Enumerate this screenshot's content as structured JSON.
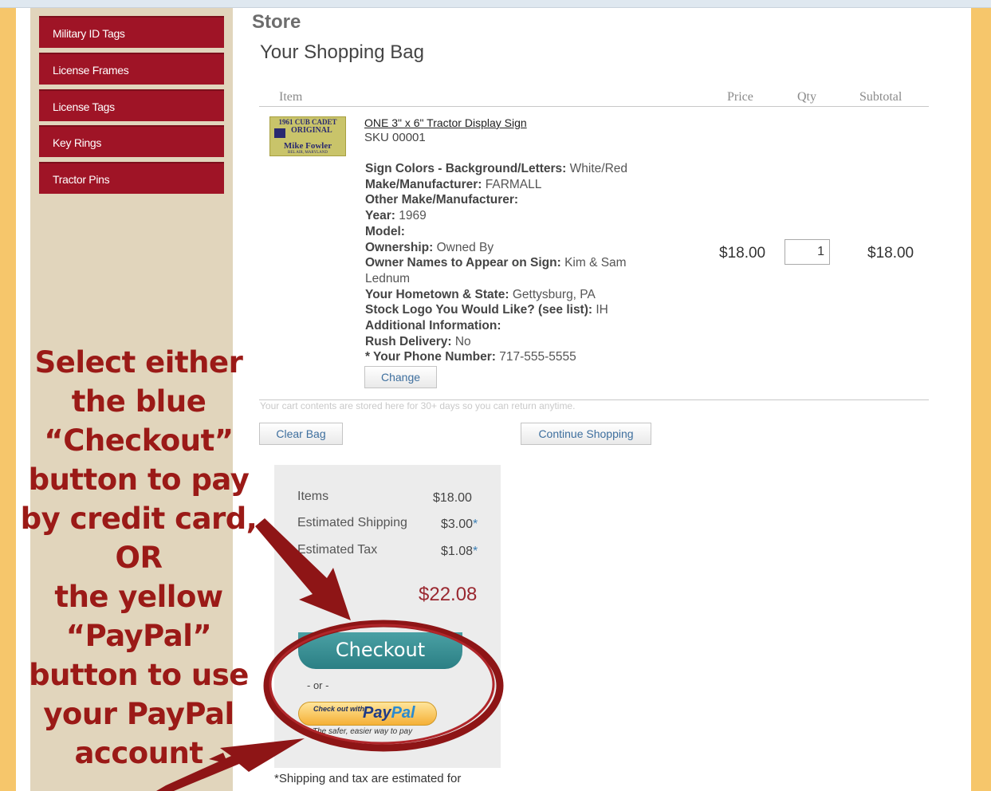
{
  "sidebar": {
    "categories": [
      "Military ID Tags",
      "License Frames",
      "License Tags",
      "Key Rings",
      "Tractor Pins"
    ]
  },
  "store": {
    "title": "Store",
    "bag_title": "Your Shopping Bag"
  },
  "cart_table": {
    "headers": {
      "item": "Item",
      "price": "Price",
      "qty": "Qty",
      "subtotal": "Subtotal"
    }
  },
  "product": {
    "thumbnail_text": [
      "1961 CUB CADET",
      "ORIGINAL",
      "Mike Fowler",
      "BEL AIR, MARYLAND"
    ],
    "name": "ONE 3\" x 6\" Tractor Display Sign",
    "sku": "SKU 00001",
    "options": [
      {
        "label": "Sign Colors - Background/Letters:",
        "value": "White/Red"
      },
      {
        "label": "Make/Manufacturer:",
        "value": "FARMALL"
      },
      {
        "label": "Other Make/Manufacturer:",
        "value": ""
      },
      {
        "label": "Year:",
        "value": "1969"
      },
      {
        "label": "Model:",
        "value": ""
      },
      {
        "label": "Ownership:",
        "value": "Owned By"
      },
      {
        "label": "Owner Names to Appear on Sign:",
        "value": "Kim & Sam Lednum"
      },
      {
        "label": "Your Hometown & State:",
        "value": "Gettysburg, PA"
      },
      {
        "label": "Stock Logo You Would Like? (see list):",
        "value": "IH"
      },
      {
        "label": "Additional Information:",
        "value": ""
      },
      {
        "label": "Rush Delivery:",
        "value": "No"
      },
      {
        "label": "* Your Phone Number:",
        "value": "717-555-5555"
      }
    ],
    "change_label": "Change",
    "price": "$18.00",
    "qty": "1",
    "subtotal": "$18.00"
  },
  "cart_note": "Your cart contents are stored here for 30+ days so you can return anytime.",
  "actions": {
    "clear_bag": "Clear Bag",
    "continue_shopping": "Continue Shopping"
  },
  "summary": {
    "items_label": "Items",
    "items_value": "$18.00",
    "shipping_label": "Estimated Shipping",
    "shipping_value": "$3.00",
    "tax_label": "Estimated Tax",
    "tax_value": "$1.08",
    "asterisk": "*",
    "total_value": "$22.08",
    "checkout_label": "Checkout",
    "or_label": "- or -",
    "paypal_small": "Check out with",
    "paypal_logo_a": "Pay",
    "paypal_logo_b": "Pal",
    "paypal_tagline": "The safer, easier way to pay",
    "footnote": "*Shipping and tax are estimated for"
  },
  "callout": {
    "lines": [
      "Select either",
      "the blue",
      "“Checkout”",
      "button to pay",
      "by credit card,",
      "OR",
      "the yellow",
      "“PayPal”",
      "button to use",
      "your PayPal",
      "account"
    ],
    "color": "#9b1a17"
  },
  "colors": {
    "category_button": "#9f1426",
    "sidebar_bg": "#e1d5bc",
    "page_edge": "#f6c66b",
    "checkout_button": "#2b7f84"
  }
}
